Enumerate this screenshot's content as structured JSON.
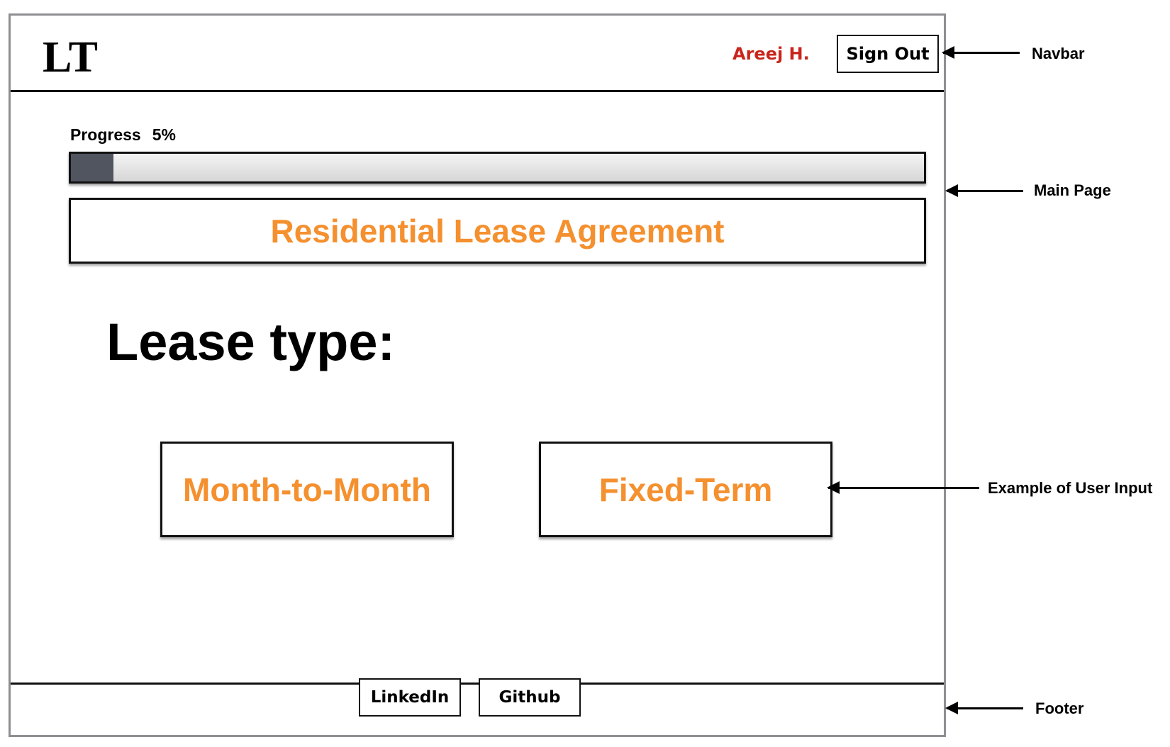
{
  "navbar": {
    "logo": "LT",
    "user_name": "Areej H.",
    "signout_label": "Sign Out"
  },
  "progress": {
    "label": "Progress",
    "percent_text": "5%",
    "value": 5
  },
  "main": {
    "title": "Residential Lease Agreement",
    "question": "Lease type:",
    "options": [
      "Month-to-Month",
      "Fixed-Term"
    ]
  },
  "footer": {
    "links": [
      "LinkedIn",
      "Github"
    ]
  },
  "annotations": {
    "navbar": "Navbar",
    "main_page": "Main Page",
    "user_input": "Example of User Input",
    "footer": "Footer"
  },
  "colors": {
    "accent_orange": "#f5902f",
    "user_red": "#c8251b",
    "progress_fill": "#505560",
    "frame_border": "#8e8e93"
  }
}
